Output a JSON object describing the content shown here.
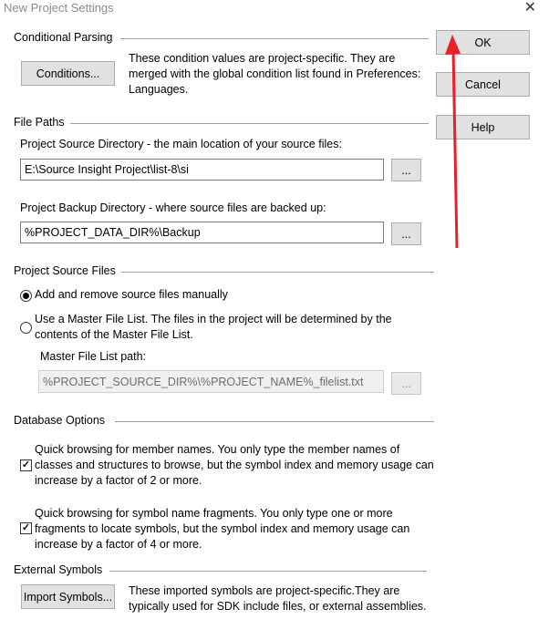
{
  "window": {
    "title": "New Project Settings",
    "close_glyph": "✕"
  },
  "buttons": {
    "ok": "OK",
    "cancel": "Cancel",
    "help": "Help"
  },
  "conditional_parsing": {
    "title": "Conditional Parsing",
    "conditions_button": "Conditions...",
    "description": "These condition values are project-specific.  They are merged with the global condition list found in Preferences: Languages."
  },
  "file_paths": {
    "title": "File Paths",
    "source_label": "Project Source Directory - the main location of your source files:",
    "source_value": "E:\\Source Insight Project\\list-8\\si",
    "backup_label": "Project Backup Directory - where source files are backed up:",
    "backup_value": "%PROJECT_DATA_DIR%\\Backup",
    "browse_label": "..."
  },
  "project_source_files": {
    "title": "Project Source Files",
    "option_manual": "Add and remove source files manually",
    "option_master": "Use a Master File List. The files in the project will be determined by the contents of the Master File List.",
    "selected": "manual",
    "master_path_label": "Master File List path:",
    "master_path_value": "%PROJECT_SOURCE_DIR%\\%PROJECT_NAME%_filelist.txt",
    "browse_label": "..."
  },
  "database_options": {
    "title": "Database Options",
    "member_names": {
      "checked": true,
      "text": "Quick browsing for member names.  You only type the member names of classes and structures to browse, but the symbol index and memory usage can increase by a factor of 2 or more."
    },
    "symbol_fragments": {
      "checked": true,
      "text": "Quick browsing for symbol name fragments.  You only type one or more fragments to locate symbols, but the symbol index and memory usage can increase by a factor of 4 or more."
    }
  },
  "external_symbols": {
    "title": "External Symbols",
    "import_button": "Import Symbols...",
    "description": "These imported symbols are project-specific.They are typically used for SDK include files, or external assemblies."
  },
  "annotation": {
    "arrow_color": "#e8202a"
  }
}
